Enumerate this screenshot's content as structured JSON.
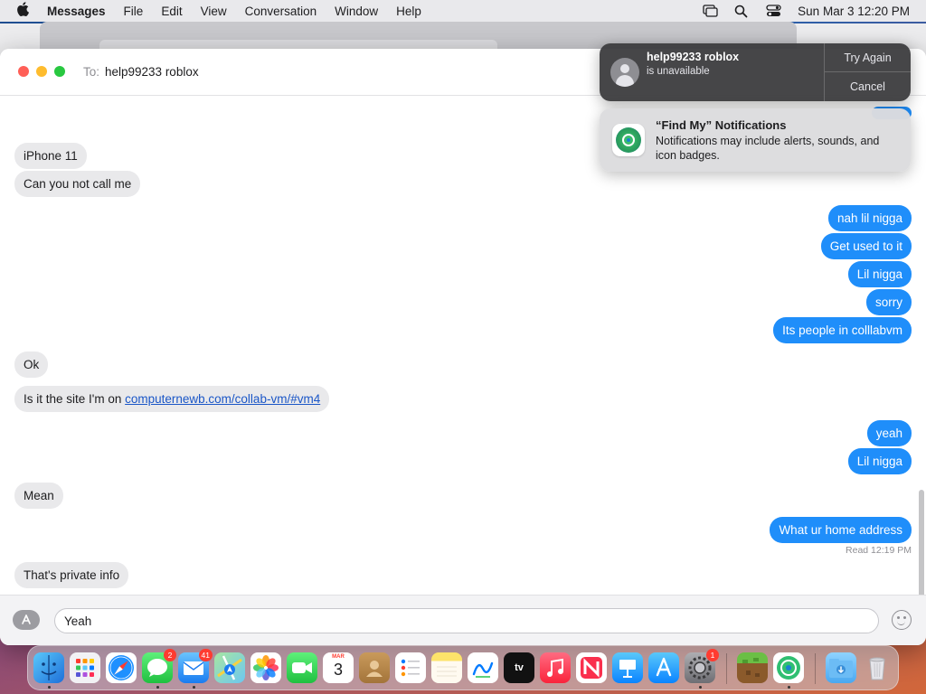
{
  "menubar": {
    "apple": "",
    "app_name": "Messages",
    "items": [
      "File",
      "Edit",
      "View",
      "Conversation",
      "Window",
      "Help"
    ],
    "datetime": "Sun Mar 3  12:20 PM"
  },
  "window": {
    "to_label": "To:",
    "recipient": "help99233 roblox"
  },
  "messages": {
    "m1": "iPhone 11",
    "m2": "Can you not call me",
    "m3": "nah lil nigga",
    "m4": "Get used to it",
    "m5": "Lil nigga",
    "m6": "sorry",
    "m7": "Its people in colllabvm",
    "m8": "Ok",
    "m9_prefix": "Is it the site I'm on ",
    "m9_link": "computernewb.com/collab-vm/#vm4",
    "m10": "yeah",
    "m11": "Lil nigga",
    "m12": "Mean",
    "m13": "What ur home address",
    "read_receipt": "Read 12:19 PM",
    "m14": "That's private info"
  },
  "composer": {
    "value": "Yeah"
  },
  "call_notification": {
    "title": "help99233 roblox",
    "subtitle": "is unavailable",
    "try_again": "Try Again",
    "cancel": "Cancel"
  },
  "findmy_notification": {
    "title": "“Find My” Notifications",
    "body": "Notifications may include alerts, sounds, and icon badges."
  },
  "dock": {
    "messages_badge": "2",
    "mail_badge": "41",
    "calendar_month": "MAR",
    "calendar_day": "3",
    "tv_label": "tv",
    "settings_badge": "1"
  },
  "colors": {
    "outgoing": "#1f8efa",
    "incoming": "#e9e9eb",
    "link": "#1a56c7"
  }
}
